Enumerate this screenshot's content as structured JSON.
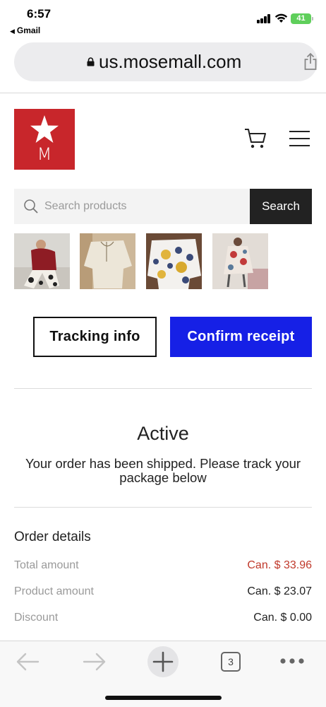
{
  "status_bar": {
    "time": "6:57",
    "back_app": "Gmail",
    "battery": "41"
  },
  "browser": {
    "url": "us.mosemall.com",
    "tabs_count": "3"
  },
  "site": {
    "logo_letter": "M",
    "search": {
      "placeholder": "Search products",
      "button_label": "Search"
    },
    "brand_color": "#c8262b"
  },
  "order": {
    "tracking_button": "Tracking info",
    "confirm_button": "Confirm receipt",
    "confirm_color": "#1620e6",
    "status_title": "Active",
    "status_message": "Your order has been shipped. Please track your package below",
    "details_title": "Order details",
    "details": [
      {
        "label": "Total amount",
        "value": "Can. $ 33.96",
        "highlight": true
      },
      {
        "label": "Product amount",
        "value": "Can. $ 23.07",
        "highlight": false
      },
      {
        "label": "Discount",
        "value": "Can. $ 0.00",
        "highlight": false
      }
    ]
  },
  "icons": {
    "lock": "lock-icon",
    "share": "share-icon",
    "cart": "cart-icon",
    "menu": "hamburger-menu-icon",
    "search": "search-icon",
    "back": "back-arrow-icon",
    "forward": "forward-arrow-icon",
    "new_tab": "plus-icon",
    "tabs": "tabs-icon",
    "more": "more-icon"
  }
}
